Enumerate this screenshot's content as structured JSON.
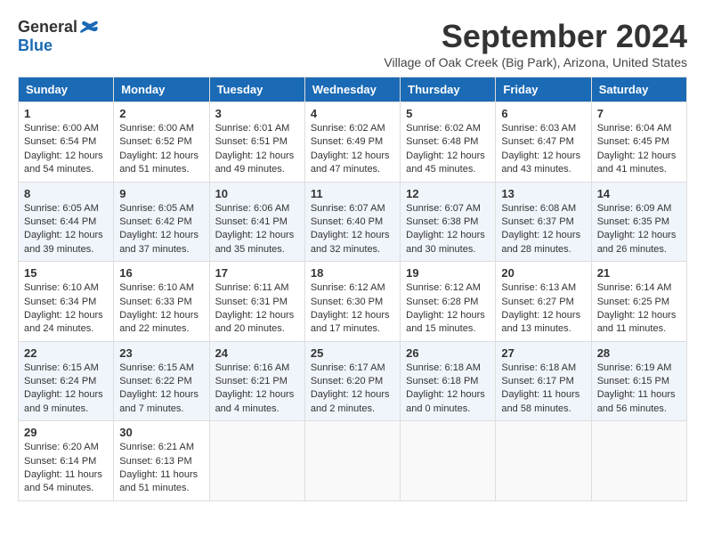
{
  "header": {
    "logo_line1": "General",
    "logo_line2": "Blue",
    "month_title": "September 2024",
    "location": "Village of Oak Creek (Big Park), Arizona, United States"
  },
  "columns": [
    "Sunday",
    "Monday",
    "Tuesday",
    "Wednesday",
    "Thursday",
    "Friday",
    "Saturday"
  ],
  "weeks": [
    [
      {
        "day": "1",
        "sunrise": "6:00 AM",
        "sunset": "6:54 PM",
        "daylight": "12 hours and 54 minutes."
      },
      {
        "day": "2",
        "sunrise": "6:00 AM",
        "sunset": "6:52 PM",
        "daylight": "12 hours and 51 minutes."
      },
      {
        "day": "3",
        "sunrise": "6:01 AM",
        "sunset": "6:51 PM",
        "daylight": "12 hours and 49 minutes."
      },
      {
        "day": "4",
        "sunrise": "6:02 AM",
        "sunset": "6:49 PM",
        "daylight": "12 hours and 47 minutes."
      },
      {
        "day": "5",
        "sunrise": "6:02 AM",
        "sunset": "6:48 PM",
        "daylight": "12 hours and 45 minutes."
      },
      {
        "day": "6",
        "sunrise": "6:03 AM",
        "sunset": "6:47 PM",
        "daylight": "12 hours and 43 minutes."
      },
      {
        "day": "7",
        "sunrise": "6:04 AM",
        "sunset": "6:45 PM",
        "daylight": "12 hours and 41 minutes."
      }
    ],
    [
      {
        "day": "8",
        "sunrise": "6:05 AM",
        "sunset": "6:44 PM",
        "daylight": "12 hours and 39 minutes."
      },
      {
        "day": "9",
        "sunrise": "6:05 AM",
        "sunset": "6:42 PM",
        "daylight": "12 hours and 37 minutes."
      },
      {
        "day": "10",
        "sunrise": "6:06 AM",
        "sunset": "6:41 PM",
        "daylight": "12 hours and 35 minutes."
      },
      {
        "day": "11",
        "sunrise": "6:07 AM",
        "sunset": "6:40 PM",
        "daylight": "12 hours and 32 minutes."
      },
      {
        "day": "12",
        "sunrise": "6:07 AM",
        "sunset": "6:38 PM",
        "daylight": "12 hours and 30 minutes."
      },
      {
        "day": "13",
        "sunrise": "6:08 AM",
        "sunset": "6:37 PM",
        "daylight": "12 hours and 28 minutes."
      },
      {
        "day": "14",
        "sunrise": "6:09 AM",
        "sunset": "6:35 PM",
        "daylight": "12 hours and 26 minutes."
      }
    ],
    [
      {
        "day": "15",
        "sunrise": "6:10 AM",
        "sunset": "6:34 PM",
        "daylight": "12 hours and 24 minutes."
      },
      {
        "day": "16",
        "sunrise": "6:10 AM",
        "sunset": "6:33 PM",
        "daylight": "12 hours and 22 minutes."
      },
      {
        "day": "17",
        "sunrise": "6:11 AM",
        "sunset": "6:31 PM",
        "daylight": "12 hours and 20 minutes."
      },
      {
        "day": "18",
        "sunrise": "6:12 AM",
        "sunset": "6:30 PM",
        "daylight": "12 hours and 17 minutes."
      },
      {
        "day": "19",
        "sunrise": "6:12 AM",
        "sunset": "6:28 PM",
        "daylight": "12 hours and 15 minutes."
      },
      {
        "day": "20",
        "sunrise": "6:13 AM",
        "sunset": "6:27 PM",
        "daylight": "12 hours and 13 minutes."
      },
      {
        "day": "21",
        "sunrise": "6:14 AM",
        "sunset": "6:25 PM",
        "daylight": "12 hours and 11 minutes."
      }
    ],
    [
      {
        "day": "22",
        "sunrise": "6:15 AM",
        "sunset": "6:24 PM",
        "daylight": "12 hours and 9 minutes."
      },
      {
        "day": "23",
        "sunrise": "6:15 AM",
        "sunset": "6:22 PM",
        "daylight": "12 hours and 7 minutes."
      },
      {
        "day": "24",
        "sunrise": "6:16 AM",
        "sunset": "6:21 PM",
        "daylight": "12 hours and 4 minutes."
      },
      {
        "day": "25",
        "sunrise": "6:17 AM",
        "sunset": "6:20 PM",
        "daylight": "12 hours and 2 minutes."
      },
      {
        "day": "26",
        "sunrise": "6:18 AM",
        "sunset": "6:18 PM",
        "daylight": "12 hours and 0 minutes."
      },
      {
        "day": "27",
        "sunrise": "6:18 AM",
        "sunset": "6:17 PM",
        "daylight": "11 hours and 58 minutes."
      },
      {
        "day": "28",
        "sunrise": "6:19 AM",
        "sunset": "6:15 PM",
        "daylight": "11 hours and 56 minutes."
      }
    ],
    [
      {
        "day": "29",
        "sunrise": "6:20 AM",
        "sunset": "6:14 PM",
        "daylight": "11 hours and 54 minutes."
      },
      {
        "day": "30",
        "sunrise": "6:21 AM",
        "sunset": "6:13 PM",
        "daylight": "11 hours and 51 minutes."
      },
      null,
      null,
      null,
      null,
      null
    ]
  ]
}
